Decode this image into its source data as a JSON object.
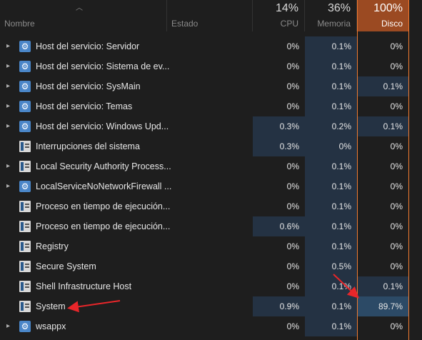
{
  "header": {
    "name_label": "Nombre",
    "estado_label": "Estado",
    "cpu": {
      "percent": "14%",
      "label": "CPU"
    },
    "memory": {
      "percent": "36%",
      "label": "Memoria"
    },
    "disk": {
      "percent": "100%",
      "label": "Disco"
    }
  },
  "rows": [
    {
      "name": "Host del servicio: Servidor",
      "cpu": "0%",
      "mem": "0.1%",
      "disk": "0%",
      "expand": true,
      "icon": "gear-icon"
    },
    {
      "name": "Host del servicio: Sistema de ev...",
      "cpu": "0%",
      "mem": "0.1%",
      "disk": "0%",
      "expand": true,
      "icon": "gear-icon"
    },
    {
      "name": "Host del servicio: SysMain",
      "cpu": "0%",
      "mem": "0.1%",
      "disk": "0.1%",
      "expand": true,
      "icon": "gear-icon"
    },
    {
      "name": "Host del servicio: Temas",
      "cpu": "0%",
      "mem": "0.1%",
      "disk": "0%",
      "expand": true,
      "icon": "gear-icon"
    },
    {
      "name": "Host del servicio: Windows Upd...",
      "cpu": "0.3%",
      "mem": "0.2%",
      "disk": "0.1%",
      "expand": true,
      "icon": "gear-icon"
    },
    {
      "name": "Interrupciones del sistema",
      "cpu": "0.3%",
      "mem": "0%",
      "disk": "0%",
      "expand": false,
      "icon": "window-icon"
    },
    {
      "name": "Local Security Authority Process...",
      "cpu": "0%",
      "mem": "0.1%",
      "disk": "0%",
      "expand": true,
      "icon": "window-icon"
    },
    {
      "name": "LocalServiceNoNetworkFirewall ...",
      "cpu": "0%",
      "mem": "0.1%",
      "disk": "0%",
      "expand": true,
      "icon": "gear-icon"
    },
    {
      "name": "Proceso en tiempo de ejecución...",
      "cpu": "0%",
      "mem": "0.1%",
      "disk": "0%",
      "expand": false,
      "icon": "window-icon"
    },
    {
      "name": "Proceso en tiempo de ejecución...",
      "cpu": "0.6%",
      "mem": "0.1%",
      "disk": "0%",
      "expand": false,
      "icon": "window-icon"
    },
    {
      "name": "Registry",
      "cpu": "0%",
      "mem": "0.1%",
      "disk": "0%",
      "expand": false,
      "icon": "window-icon"
    },
    {
      "name": "Secure System",
      "cpu": "0%",
      "mem": "0.5%",
      "disk": "0%",
      "expand": false,
      "icon": "window-icon"
    },
    {
      "name": "Shell Infrastructure Host",
      "cpu": "0%",
      "mem": "0.1%",
      "disk": "0.1%",
      "expand": false,
      "icon": "window-icon"
    },
    {
      "name": "System",
      "cpu": "0.9%",
      "mem": "0.1%",
      "disk": "89.7%",
      "expand": false,
      "icon": "window-icon"
    },
    {
      "name": "wsappx",
      "cpu": "0%",
      "mem": "0.1%",
      "disk": "0%",
      "expand": true,
      "icon": "gear-icon"
    }
  ],
  "colors": {
    "accent_border": "#f07a30",
    "disk_header_bg": "#9b4a22",
    "arrow": "#e8262a"
  }
}
